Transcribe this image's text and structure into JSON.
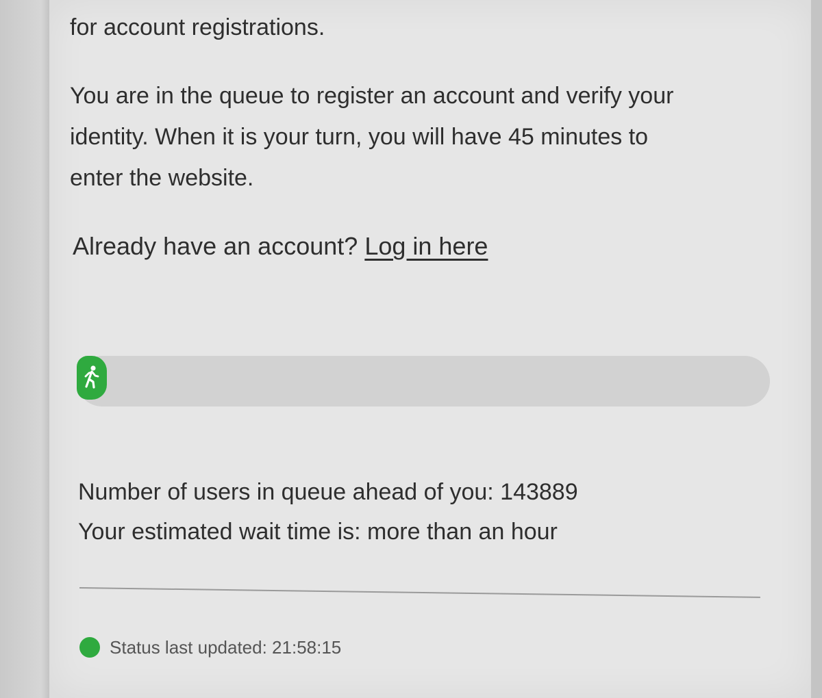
{
  "content": {
    "intro_tail": "for account registrations.",
    "queue_paragraph": {
      "line1": "You are in the queue to register an account and verify your",
      "line2": "identity. When it is your turn, you will have 45 minutes to",
      "line3": "enter the website."
    },
    "login_prompt": "Already have an account?",
    "login_link": "Log in here"
  },
  "progress": {
    "icon": "walking-person-icon",
    "fraction": 0.04,
    "fill_color": "#2faa3f"
  },
  "queue": {
    "ahead_label": "Number of users in queue ahead of you: 143889",
    "wait_label": "Your estimated wait time is: more than an hour"
  },
  "status": {
    "indicator_color": "#2faa3f",
    "text": "Status last updated: 21:58:15"
  }
}
